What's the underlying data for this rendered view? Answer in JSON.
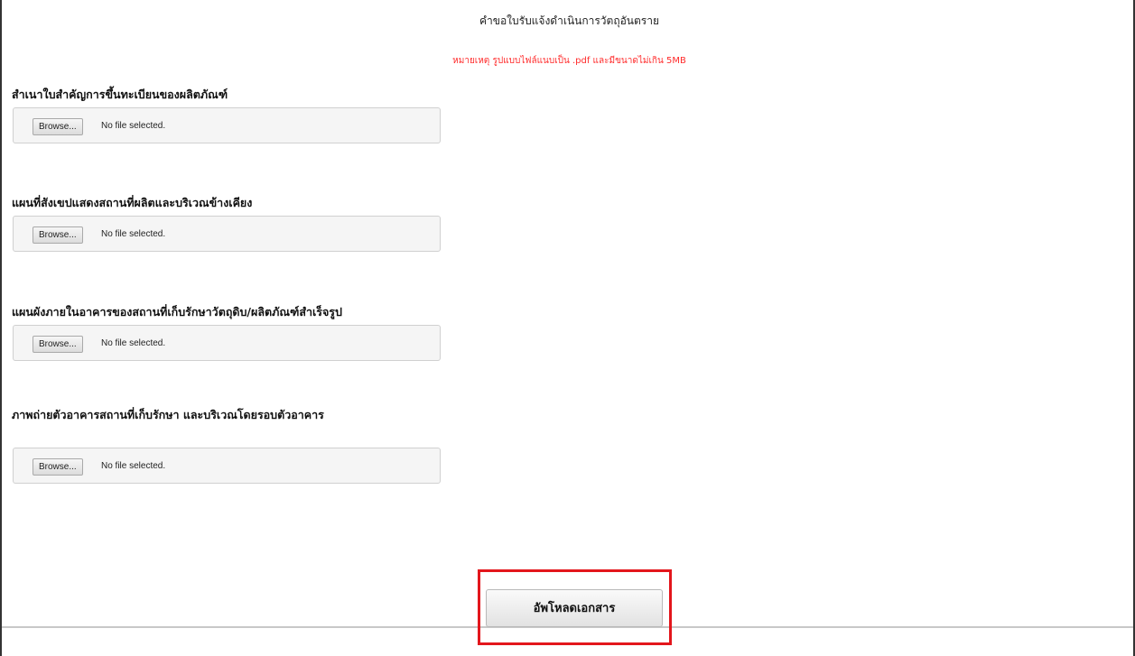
{
  "form": {
    "title": "คำขอใบรับแจ้งดำเนินการวัตถุอันตราย",
    "note": "หมายเหตุ รูปแบบไฟล์แนบเป็น .pdf และมีขนาดไม่เกิน 5MB",
    "fields": [
      {
        "label": "สำเนาใบสำคัญการขึ้นทะเบียนของผลิตภัณฑ์",
        "browse_label": "Browse...",
        "status": "No file selected."
      },
      {
        "label": "แผนที่สังเขปแสดงสถานที่ผลิตและบริเวณข้างเคียง",
        "browse_label": "Browse...",
        "status": "No file selected."
      },
      {
        "label": "แผนผังภายในอาคารของสถานที่เก็บรักษาวัตถุดิบ/ผลิตภัณฑ์สำเร็จรูป",
        "browse_label": "Browse...",
        "status": "No file selected."
      },
      {
        "label": "ภาพถ่ายตัวอาคารสถานที่เก็บรักษา และบริเวณโดยรอบตัวอาคาร",
        "browse_label": "Browse...",
        "status": "No file selected."
      }
    ],
    "upload_label": "อัพโหลดเอกสาร"
  },
  "colors": {
    "note": "#ff2b2b",
    "highlight": "#e3161c"
  }
}
